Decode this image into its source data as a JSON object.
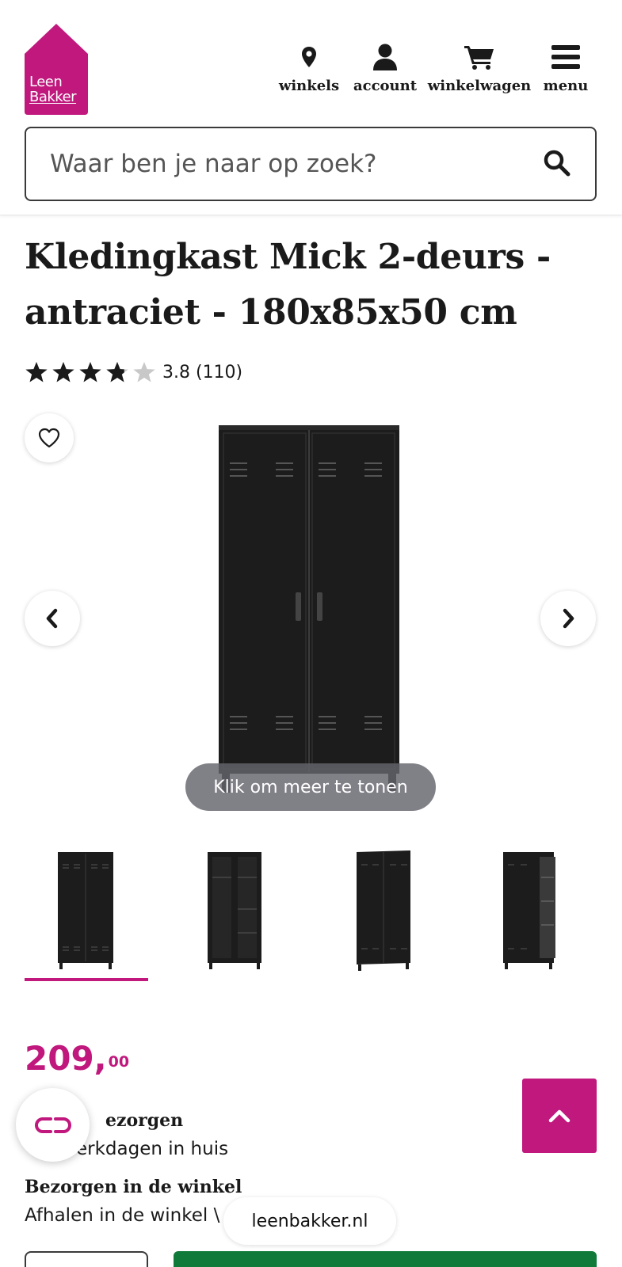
{
  "header": {
    "logo": {
      "line1": "Leen",
      "line2": "Bakker",
      "color": "#c0187d"
    },
    "nav": [
      {
        "label": "winkels",
        "icon": "map-pin-icon"
      },
      {
        "label": "account",
        "icon": "user-icon"
      },
      {
        "label": "winkelwagen",
        "icon": "shopping-cart-icon"
      },
      {
        "label": "menu",
        "icon": "hamburger-menu-icon"
      }
    ],
    "search": {
      "placeholder": "Waar ben je naar op zoek?",
      "value": "",
      "icon": "search-icon"
    }
  },
  "product": {
    "title": "Kledingkast Mick 2-deurs - antraciet - 180x85x50 cm",
    "rating": {
      "stars": 3.8,
      "max": 5,
      "text": "3.8 (110)"
    },
    "gallery": {
      "more_label": "Klik om meer te tonen",
      "thumbnails": [
        "closed-doors",
        "open-interior",
        "closed-doors-angle",
        "half-open"
      ],
      "selected_index": 0
    },
    "price": {
      "whole": "209,",
      "cents": "00",
      "color": "#c0187d"
    },
    "delivery": {
      "home_title_partial": "ezorgen",
      "home_sub_partial": "erkdagen in huis",
      "store_title": "Bezorgen in de winkel",
      "store_sub_partial": "Afhalen in de winkel \\"
    }
  },
  "browser": {
    "url": "leenbakker.nl"
  },
  "colors": {
    "brand": "#c0187d",
    "cta": "#0f7a3a",
    "text": "#1a1a1a"
  }
}
